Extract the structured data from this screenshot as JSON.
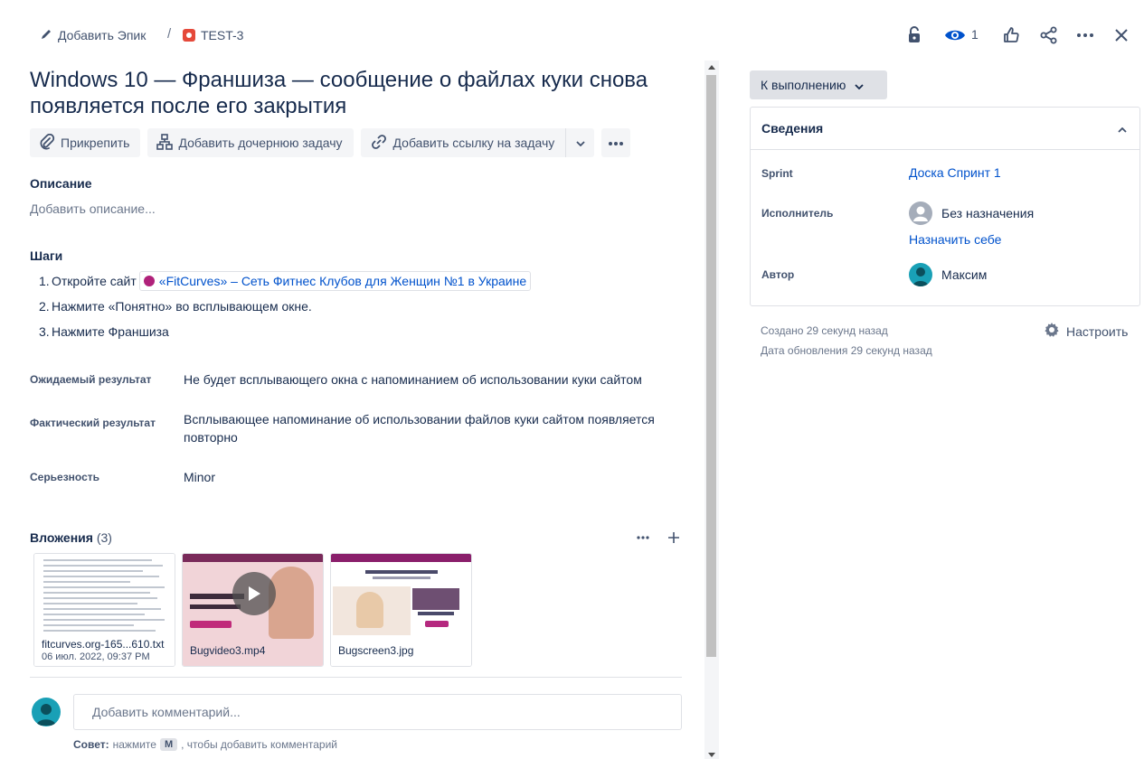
{
  "header": {
    "add_epic": "Добавить Эпик",
    "separator": "/",
    "issue_key": "TEST-3",
    "watch_count": "1"
  },
  "issue": {
    "title": "Windows 10 — Франшиза — сообщение о файлах куки снова появляется после его закрытия"
  },
  "actions": {
    "attach": "Прикрепить",
    "add_child": "Добавить дочернюю задачу",
    "add_link": "Добавить ссылку на задачу"
  },
  "description": {
    "label": "Описание",
    "placeholder": "Добавить описание..."
  },
  "steps": {
    "label": "Шаги",
    "items": [
      {
        "num": "1.",
        "text": "Откройте сайт",
        "link": "«FitCurves» – Сеть Фитнес Клубов для Женщин №1 в Украине"
      },
      {
        "num": "2.",
        "text": "Нажмите «Понятно» во всплывающем окне."
      },
      {
        "num": "3.",
        "text": "Нажмите Франшиза"
      }
    ]
  },
  "fields": {
    "expected_label": "Ожидаемый результат",
    "expected_value": "Не будет всплывающего окна с напоминанием об использовании куки сайтом",
    "actual_label": "Фактический результат",
    "actual_value": "Всплывающее напоминание об использовании файлов куки сайтом появляется повторно",
    "severity_label": "Серьезность",
    "severity_value": "Minor"
  },
  "attachments": {
    "label": "Вложения",
    "count": "(3)",
    "items": [
      {
        "name": "fitcurves.org-165...610.txt",
        "date": "06 июл. 2022, 09:37 PM"
      },
      {
        "name": "Bugvideo3.mp4"
      },
      {
        "name": "Bugscreen3.jpg"
      }
    ]
  },
  "comment": {
    "placeholder": "Добавить комментарий...",
    "tip_prefix": "Совет:",
    "tip_middle": "нажмите",
    "tip_key": "M",
    "tip_suffix": ", чтобы добавить комментарий"
  },
  "sidebar": {
    "status": "К выполнению",
    "details_title": "Сведения",
    "sprint_label": "Sprint",
    "sprint_value": "Доска Спринт 1",
    "assignee_label": "Исполнитель",
    "assignee_value": "Без назначения",
    "assign_self": "Назначить себе",
    "reporter_label": "Автор",
    "reporter_value": "Максим",
    "created": "Создано 29 секунд назад",
    "updated": "Дата обновления 29 секунд назад",
    "configure": "Настроить"
  },
  "colors": {
    "link": "#0052cc",
    "text": "#172b4d",
    "subtle": "#42526e",
    "bug": "#e5493a",
    "avatar": "#19a0b6"
  }
}
